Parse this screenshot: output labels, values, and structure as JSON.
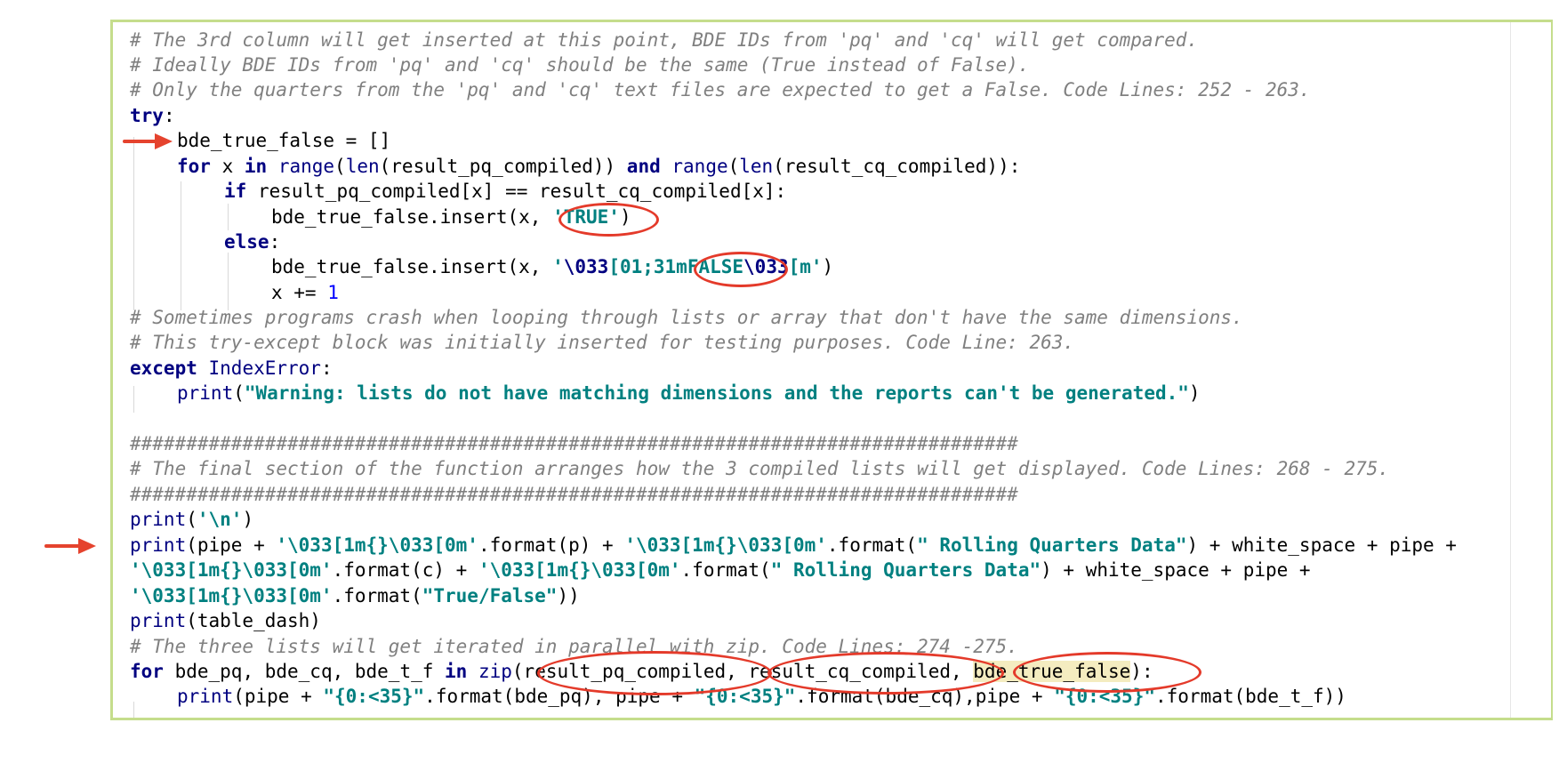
{
  "code": {
    "line1": "# The 3rd column will get inserted at this point, BDE IDs from 'pq' and 'cq' will get compared.",
    "line2": "# Ideally BDE IDs from 'pq' and 'cq' should be the same (True instead of False).",
    "line3": "# Only the quarters from the 'pq' and 'cq' text files are expected to get a False. Code Lines: 252 - 263.",
    "line4_kw": "try",
    "line4_punct": ":",
    "line5": "bde_true_false = []",
    "line6_for": "for",
    "line6_x": " x ",
    "line6_in": "in",
    "line6_range1": "range",
    "line6_p1": "(",
    "line6_len1": "len",
    "line6_arg1": "(result_pq_compiled)) ",
    "line6_and": "and",
    "line6_sp": " ",
    "line6_range2": "range",
    "line6_p2": "(",
    "line6_len2": "len",
    "line6_arg2": "(result_cq_compiled)):",
    "line7_if": "if",
    "line7_rest": " result_pq_compiled[x] == result_cq_compiled[x]:",
    "line8_call": "bde_true_false.insert(x, ",
    "line8_str": "'TRUE'",
    "line8_end": ")",
    "line9_else": "else",
    "line9_punct": ":",
    "line10_call": "bde_true_false.insert(x, ",
    "line10_str_a": "'",
    "line10_esc1": "\\033",
    "line10_str_b": "[01;31mFALSE",
    "line10_esc2": "\\033",
    "line10_str_c": "[m'",
    "line10_end": ")",
    "line11_x": "x += ",
    "line11_num": "1",
    "line12": "# Sometimes programs crash when looping through lists or array that don't have the same dimensions.",
    "line13": "# This try-except block was initially inserted for testing purposes. Code Line: 263.",
    "line14_kw": "except",
    "line14_sp": " ",
    "line14_err": "IndexError",
    "line14_punct": ":",
    "line15_print": "print",
    "line15_p": "(",
    "line15_str": "\"Warning: lists do not have matching dimensions and the reports can't be generated.\"",
    "line15_end": ")",
    "line17": "###############################################################################",
    "line18": "# The final section of the function arranges how the 3 compiled lists will get displayed. Code Lines: 268 - 275.",
    "line19": "###############################################################################",
    "line20_print": "print",
    "line20_p": "(",
    "line20_str": "'\\n'",
    "line20_end": ")",
    "line21_print": "print",
    "line21_a": "(pipe + ",
    "line21_s1": "'\\033[1m{}\\033[0m'",
    "line21_b": ".format(p) + ",
    "line21_s2": "'\\033[1m{}\\033[0m'",
    "line21_c": ".format(",
    "line21_s3": "\" Rolling Quarters Data\"",
    "line21_d": ") + white_space + pipe +",
    "line22_s1": "'\\033[1m{}\\033[0m'",
    "line22_a": ".format(c) + ",
    "line22_s2": "'\\033[1m{}\\033[0m'",
    "line22_b": ".format(",
    "line22_s3": "\" Rolling Quarters Data\"",
    "line22_c": ") + white_space + pipe +",
    "line23_s1": "'\\033[1m{}\\033[0m'",
    "line23_a": ".format(",
    "line23_s2": "\"True/False\"",
    "line23_b": "))",
    "line24_print": "print",
    "line24_rest": "(table_dash)",
    "line25": "# The three lists will get iterated in parallel with zip. Code Lines: 274 -275.",
    "line26_for": "for",
    "line26_vars": " bde_pq, bde_cq, bde_t_f ",
    "line26_in": "in",
    "line26_sp": " ",
    "line26_zip": "zip",
    "line26_a": "(result_pq_compiled, result_cq_compiled, ",
    "line26_hl": "bde_true_false",
    "line26_b": "):",
    "line27_print": "print",
    "line27_a": "(pipe + ",
    "line27_s1": "\"{0:<35}\"",
    "line27_b": ".format(bde_pq), pipe + ",
    "line27_s2": "\"{0:<35}\"",
    "line27_c": ".format(bde_cq),pipe + ",
    "line27_s3": "\"{0:<35}\"",
    "line27_d": ".format(bde_t_f))"
  },
  "annotations": {
    "arrow_color": "#e5432e",
    "ellipse_color": "#e43a2a",
    "frame_color": "#c5dd8c"
  }
}
